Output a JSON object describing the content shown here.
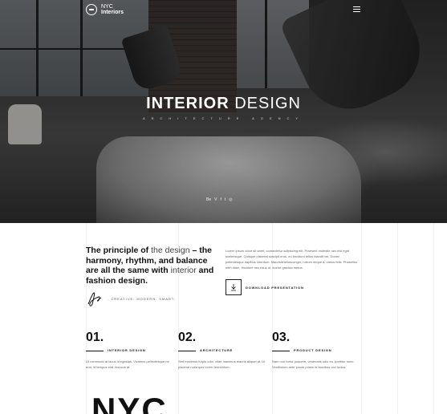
{
  "logo": {
    "line1": "NYC",
    "line2": "Interiors"
  },
  "hero": {
    "title_bold": "INTERIOR",
    "title_light": "DESIGN",
    "subtitle": "ARCHITECTURE AGENCY",
    "socials": [
      "Be",
      "V",
      "f",
      "t",
      "◎"
    ]
  },
  "intro": {
    "heading_part1": "The principle of",
    "heading_light1": " the design",
    "heading_part2": " – the harmony, rhythm, and balance are all the same with ",
    "heading_light2": "interior",
    "heading_part3": " and fashion design.",
    "signature_tagline": "- CREATIVE. MODERN. SMART.",
    "body": "Lorem ipsum dolor sit amet, consectetur adipiscing elit. Praesent molestie nec nisl eget scelerisque. Quisque placerat suscipit eros, eu tincidunt tellus blandit vel. Donec pellentesque dapibus interdum. Mauris#Hellusconger, rutrum neque a, varius felis. Phasellus nibh diam, tincidunt nec risus ut, auctor gravida metus.",
    "download_label": "DOWNLOAD PRESENTATION"
  },
  "features": [
    {
      "num": "01.",
      "label": "INTERIOR DESIGN",
      "desc": "Ut commodo at lacus id egestas. Vivamus pellentesque mi erat, id tempus erat rhoncus at."
    },
    {
      "num": "02.",
      "label": "ARCHITECTURE",
      "desc": "Sed maximus turpis odio, vitae maximus mauris aliquet at. Ut placerat nulla quis lorem fermentum."
    },
    {
      "num": "03.",
      "label": "PRODUCT DESIGN",
      "desc": "Nam non tortor posuere, venenatis odio eu, porttitor nunc. Vestibulum ante ipsum primis in faucibus orci luctus."
    }
  ],
  "footer_big": "NYC"
}
